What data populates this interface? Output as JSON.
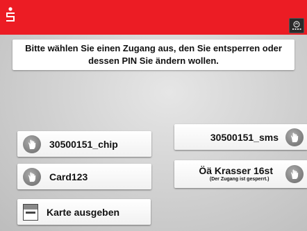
{
  "prompt": "Bitte wählen Sie einen Zugang aus, den Sie entsperren oder dessen PIN Sie ändern wollen.",
  "accounts": {
    "left_top": "30500151_chip",
    "right_top": "30500151_sms",
    "left_middle": "Card123",
    "right_middle": "Öä Krasser 16st",
    "right_middle_note": "(Der Zugang ist gesperrt.)"
  },
  "card_eject_label": "Karte ausgeben",
  "colors": {
    "header": "#ec1c24",
    "button": "#ffffff"
  },
  "icons": [
    "sparkasse-logo-icon",
    "accessibility-icon",
    "hand-icon",
    "card-eject-icon"
  ]
}
